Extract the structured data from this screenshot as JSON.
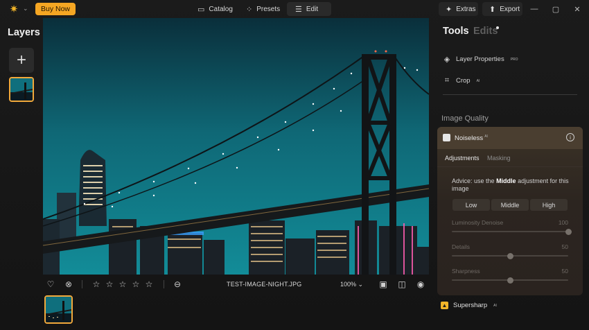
{
  "titlebar": {
    "buy_now": "Buy Now",
    "tabs": [
      {
        "label": "Catalog",
        "icon": "folder-icon"
      },
      {
        "label": "Presets",
        "icon": "sparkle-icon"
      },
      {
        "label": "Edit",
        "icon": "sliders-icon",
        "active": true
      }
    ],
    "extras": "Extras",
    "export": "Export"
  },
  "layers": {
    "title": "Layers",
    "add_symbol": "+"
  },
  "bottombar": {
    "filename": "TEST-IMAGE-NIGHT.JPG",
    "zoom": "100%",
    "rating": 0,
    "max_rating": 5
  },
  "right_panel": {
    "tab_tools": "Tools",
    "tab_edits": "Edits",
    "tools": [
      {
        "label": "Layer Properties",
        "badge": "PRO",
        "icon": "layers-icon"
      },
      {
        "label": "Crop",
        "badge": "AI",
        "icon": "crop-icon"
      }
    ],
    "section_title": "Image Quality",
    "noiseless": {
      "title": "Noiseless",
      "badge": "AI",
      "tabs": [
        "Adjustments",
        "Masking"
      ],
      "advice_prefix": "Advice: use the",
      "advice_bold": "Middle",
      "advice_suffix": "adjustment for this image",
      "levels": [
        "Low",
        "Middle",
        "High"
      ],
      "sliders": [
        {
          "label": "Luminosity Denoise",
          "value": "100",
          "fraction": 1.0
        },
        {
          "label": "Details",
          "value": "50",
          "fraction": 0.5
        },
        {
          "label": "Sharpness",
          "value": "50",
          "fraction": 0.5
        }
      ]
    },
    "supersharp": {
      "title": "Supersharp",
      "badge": "AI"
    }
  },
  "colors": {
    "accent": "#f5a623",
    "selection_border": "#f2a93b",
    "sky": "#0f6f7d"
  }
}
